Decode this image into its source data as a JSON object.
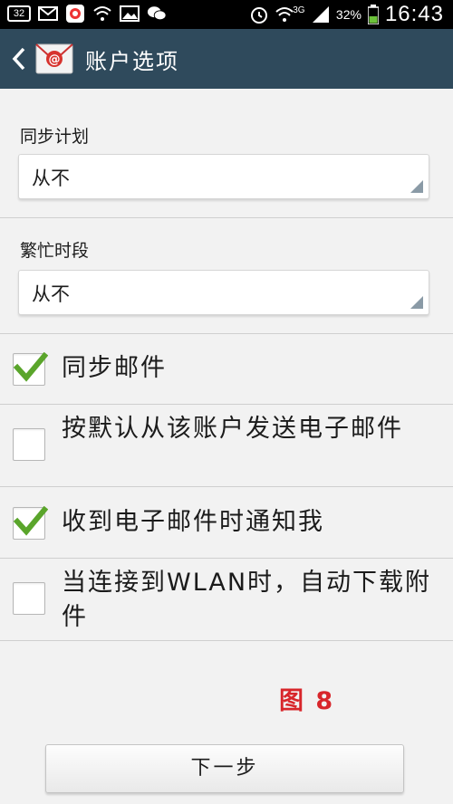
{
  "status_bar": {
    "badge_count": "32",
    "network_type": "3G",
    "battery": "32%",
    "time": "16:43",
    "icons": [
      "notification-count-icon",
      "mail-icon",
      "app-store-icon",
      "wifi-icon",
      "gallery-icon",
      "wechat-icon",
      "alarm-icon",
      "wifi-signal-icon",
      "signal-icon",
      "battery-icon"
    ]
  },
  "header": {
    "title": "账户选项",
    "back_icon": "chevron-left-icon",
    "app_icon": "email-app-icon"
  },
  "settings": {
    "sync_schedule": {
      "label": "同步计划",
      "value": "从不"
    },
    "peak_schedule": {
      "label": "繁忙时段",
      "value": "从不"
    }
  },
  "checkboxes": [
    {
      "label": "同步邮件",
      "checked": true
    },
    {
      "label": "按默认从该账户发送电子邮件",
      "checked": false
    },
    {
      "label": "收到电子邮件时通知我",
      "checked": true
    },
    {
      "label": "当连接到WLAN时，自动下载附件",
      "checked": false
    }
  ],
  "figure_label": "图 8",
  "next_button": "下一步",
  "colors": {
    "action_bar": "#2f4a5c",
    "check_green": "#5aa52b",
    "figure_red": "#d8262b"
  }
}
